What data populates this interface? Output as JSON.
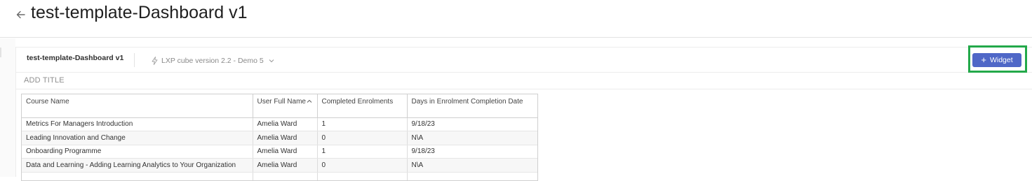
{
  "header": {
    "title": "test-template-Dashboard v1"
  },
  "toolbar": {
    "dashboard_name": "test-template-Dashboard v1",
    "cube_label": "LXP cube version 2.2 - Demo 5",
    "widget_button_label": "Widget"
  },
  "add_title_placeholder": "ADD TITLE",
  "table": {
    "columns": [
      "Course Name",
      "User Full Name",
      "Completed Enrolments",
      "Days in Enrolment Completion Date"
    ],
    "rows": [
      [
        "Metrics For Managers Introduction",
        "Amelia Ward",
        "1",
        "9/18/23"
      ],
      [
        "Leading Innovation and Change",
        "Amelia Ward",
        "0",
        "N\\A"
      ],
      [
        "Onboarding Programme",
        "Amelia Ward",
        "1",
        "9/18/23"
      ],
      [
        "Data and Learning - Adding Learning Analytics to Your Organization",
        "Amelia Ward",
        "0",
        "N\\A"
      ]
    ]
  },
  "colors": {
    "accent": "#4f67c7",
    "highlight": "#23a94a"
  }
}
